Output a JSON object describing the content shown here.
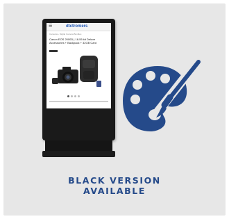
{
  "colors": {
    "background": "#e7e7e7",
    "accent": "#254a8a",
    "kiosk": "#1a1a1a"
  },
  "icons": {
    "feature": "palette-icon"
  },
  "caption": {
    "line1": "BLACK VERSION",
    "line2": "AVAILABLE"
  }
}
